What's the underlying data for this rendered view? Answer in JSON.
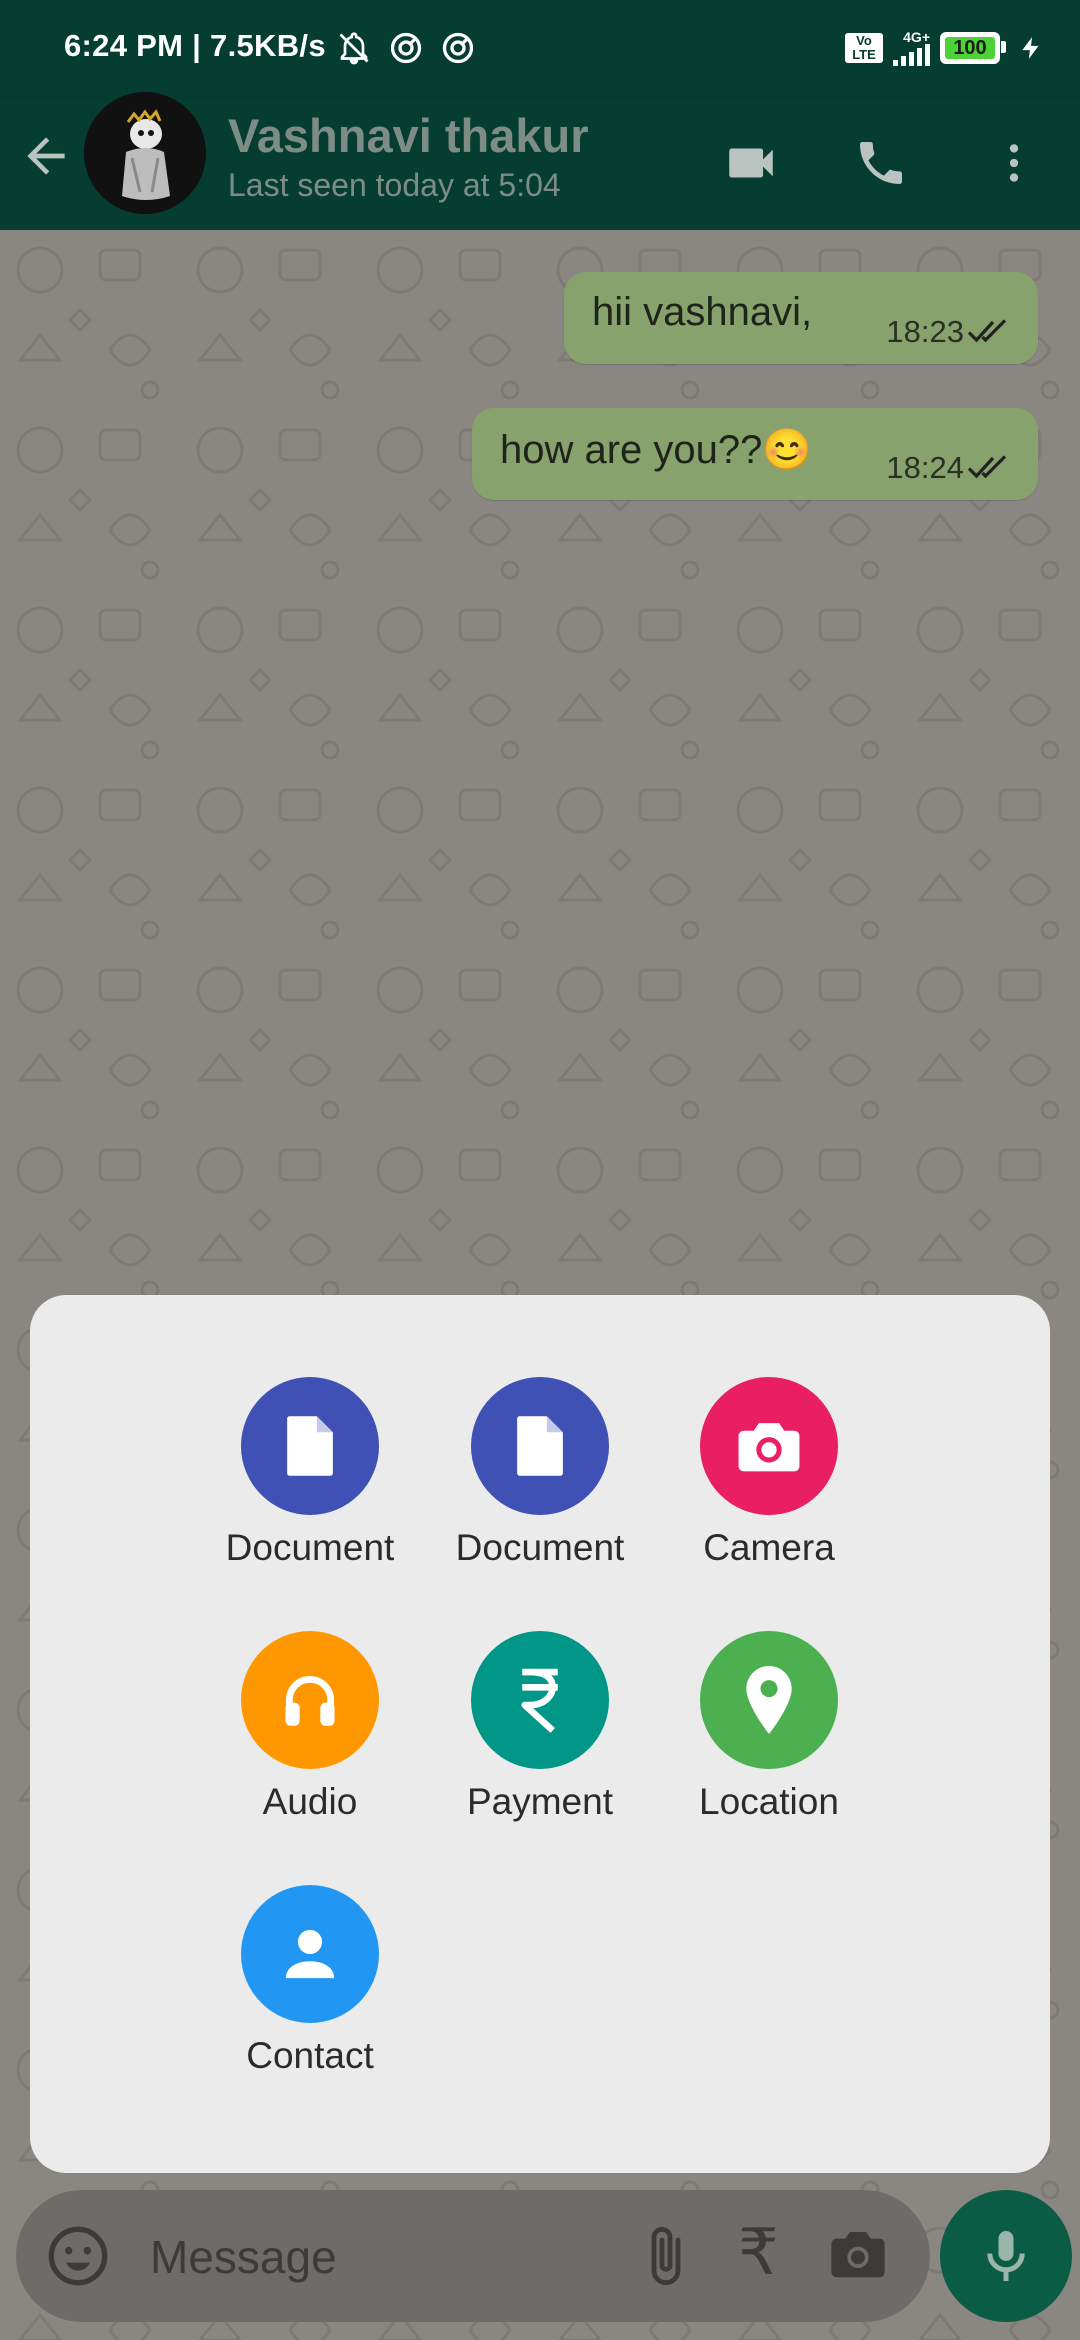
{
  "status_bar": {
    "time_speed": "6:24 PM | 7.5KB/s",
    "volte": "Vo LTE",
    "network": "4G+",
    "battery": "100"
  },
  "header": {
    "contact_name": "Vashnavi thakur",
    "last_seen": "Last seen today at 5:04"
  },
  "messages": [
    {
      "text": "hii vashnavi,",
      "time": "18:23"
    },
    {
      "text": "how are you??😊",
      "time": "18:24"
    }
  ],
  "attachments": [
    {
      "label": "Document",
      "icon": "document-icon",
      "color": "#3f51b5"
    },
    {
      "label": "Document",
      "icon": "document-icon",
      "color": "#3f51b5"
    },
    {
      "label": "Camera",
      "icon": "camera-icon",
      "color": "#e91e63"
    },
    {
      "label": "Audio",
      "icon": "headphones-icon",
      "color": "#ff9800"
    },
    {
      "label": "Payment",
      "icon": "rupee-icon",
      "color": "#009688"
    },
    {
      "label": "Location",
      "icon": "location-pin-icon",
      "color": "#4caf50"
    },
    {
      "label": "Contact",
      "icon": "person-icon",
      "color": "#2196f3"
    }
  ],
  "composer": {
    "placeholder": "Message",
    "payment_glyph": "₹"
  },
  "colors": {
    "header": "#053d30",
    "bubble": "#88a26e",
    "mic_button": "#0b5c45"
  }
}
